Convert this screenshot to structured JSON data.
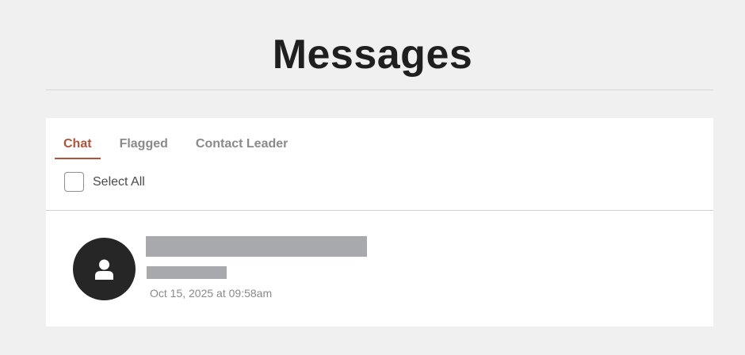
{
  "header": {
    "title": "Messages"
  },
  "tabs": [
    {
      "label": "Chat",
      "active": true
    },
    {
      "label": "Flagged",
      "active": false
    },
    {
      "label": "Contact Leader",
      "active": false
    }
  ],
  "select_all": {
    "label": "Select All",
    "checked": false
  },
  "messages": [
    {
      "avatar_icon": "user-icon",
      "timestamp": "Oct 15, 2025 at 09:58am"
    }
  ],
  "colors": {
    "background": "#f0f0f0",
    "accent": "#b0533a",
    "redaction": "#a8a9ad",
    "avatar": "#262626"
  }
}
